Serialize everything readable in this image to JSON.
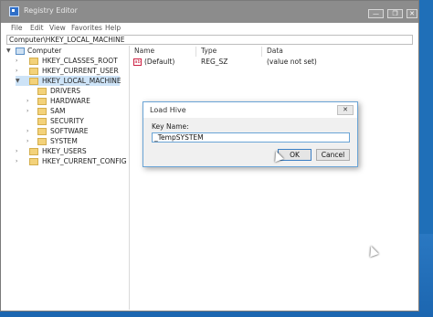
{
  "window": {
    "title": "Registry Editor",
    "minimize_glyph": "—",
    "maximize_glyph": "❐",
    "close_glyph": "✕"
  },
  "menu": [
    "File",
    "Edit",
    "View",
    "Favorites",
    "Help"
  ],
  "address": "Computer\\HKEY_LOCAL_MACHINE",
  "tree": {
    "root": "Computer",
    "items": [
      "HKEY_CLASSES_ROOT",
      "HKEY_CURRENT_USER",
      "HKEY_LOCAL_MACHINE",
      "DRIVERS",
      "HARDWARE",
      "SAM",
      "SECURITY",
      "SOFTWARE",
      "SYSTEM",
      "HKEY_USERS",
      "HKEY_CURRENT_CONFIG"
    ],
    "selected": "HKEY_LOCAL_MACHINE"
  },
  "list": {
    "headers": [
      "Name",
      "Type",
      "Data"
    ],
    "rows": [
      {
        "icon": "ab",
        "name": "(Default)",
        "type": "REG_SZ",
        "data": "(value not set)"
      }
    ]
  },
  "dialog": {
    "title": "Load Hive",
    "close_glyph": "✕",
    "key_label": "Key Name:",
    "key_value": "_TempSYSTEM",
    "ok_label": "OK",
    "cancel_label": "Cancel"
  },
  "colors": {
    "desktop": "#1f6fb8",
    "titlebar": "#8c8c8c",
    "selection": "#cde3f7",
    "dialog_border": "#6aa4d6"
  }
}
